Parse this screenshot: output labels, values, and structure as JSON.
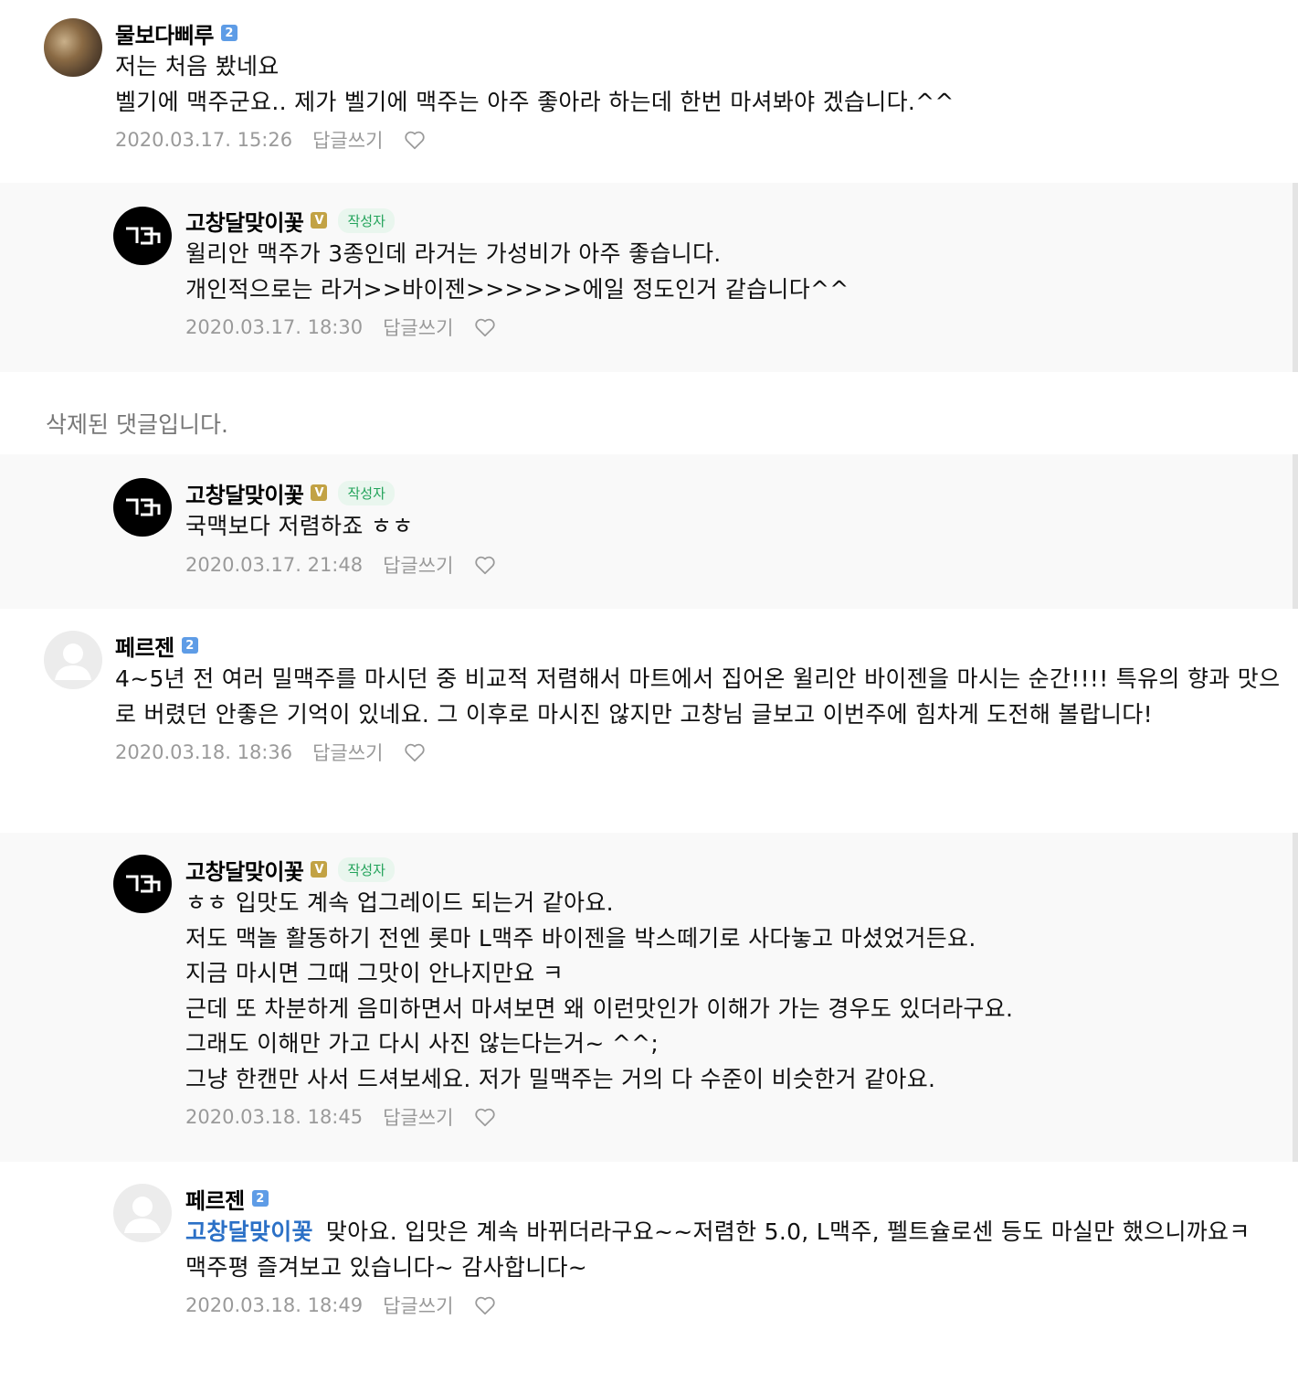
{
  "reply_label": "답글쓰기",
  "author_badge": "작성자",
  "comments": [
    {
      "nickname": "물보다삐루",
      "level": "2",
      "lines": [
        "저는 처음 봤네요",
        "벨기에 맥주군요.. 제가 벨기에 맥주는 아주 좋아라 하는데 한번 마셔봐야 겠습니다.^^"
      ],
      "date": "2020.03.17. 15:26"
    },
    {
      "nickname": "고창달맞이꽃",
      "level": "V",
      "lines": [
        "윌리안 맥주가 3종인데 라거는 가성비가 아주 좋습니다.",
        "개인적으로는 라거>>바이젠>>>>>>에일 정도인거 같습니다^^"
      ],
      "date": "2020.03.17. 18:30"
    },
    {
      "deleted_text": "삭제된 댓글입니다."
    },
    {
      "nickname": "고창달맞이꽃",
      "level": "V",
      "lines": [
        "국맥보다 저렴하죠 ㅎㅎ"
      ],
      "date": "2020.03.17. 21:48"
    },
    {
      "nickname": "페르젠",
      "level": "2",
      "paragraph": "4~5년 전 여러 밀맥주를 마시던 중 비교적 저렴해서 마트에서 집어온 윌리안 바이젠을 마시는 순간!!!! 특유의 향과 맛으로 버렸던 안좋은 기억이 있네요. 그 이후로 마시진 않지만 고창님 글보고 이번주에 힘차게 도전해 볼랍니다!",
      "date": "2020.03.18. 18:36"
    },
    {
      "nickname": "고창달맞이꽃",
      "level": "V",
      "lines": [
        "ㅎㅎ 입맛도 계속 업그레이드 되는거 같아요.",
        "저도 맥놀 활동하기 전엔 롯마 L맥주 바이젠을 박스떼기로 사다놓고 마셨었거든요.",
        "지금 마시면 그때 그맛이 안나지만요 ㅋ",
        "근데 또 차분하게 음미하면서 마셔보면 왜 이런맛인가 이해가 가는 경우도 있더라구요.",
        "그래도 이해만 가고 다시 사진 않는다는거~ ^^;",
        "그냥 한캔만 사서 드셔보세요. 저가 밀맥주는 거의 다 수준이 비슷한거 같아요."
      ],
      "date": "2020.03.18. 18:45"
    },
    {
      "nickname": "페르젠",
      "level": "2",
      "mention": "고창달맞이꽃",
      "paragraph": "맞아요. 입맛은 계속 바뀌더라구요~~저렴한 5.0, L맥주, 펠트슐로센 등도 마실만 했으니까요ㅋ",
      "line2": "맥주평 즐겨보고 있습니다~ 감사합니다~",
      "date": "2020.03.18. 18:49"
    }
  ]
}
